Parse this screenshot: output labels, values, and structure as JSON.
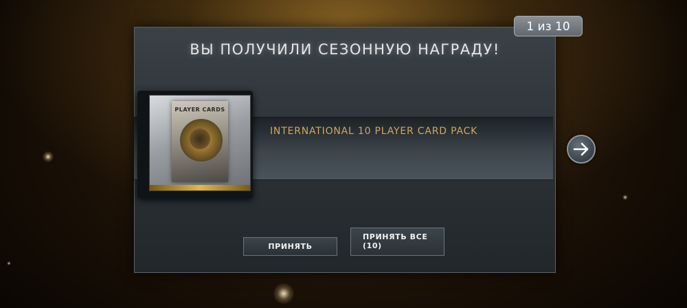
{
  "dialog": {
    "title": "ВЫ ПОЛУЧИЛИ СЕЗОННУЮ НАГРАДУ!",
    "counter": "1  из 10"
  },
  "reward": {
    "name": "INTERNATIONAL 10 PLAYER CARD PACK",
    "image_label": "PLAYER CARDS",
    "name_color": "#d7a55c"
  },
  "navigation": {
    "next_icon": "arrow-right-icon"
  },
  "buttons": {
    "accept_label": "ПРИНЯТЬ",
    "accept_all_label": "ПРИНЯТЬ ВСЕ",
    "accept_all_count": "(10)"
  }
}
